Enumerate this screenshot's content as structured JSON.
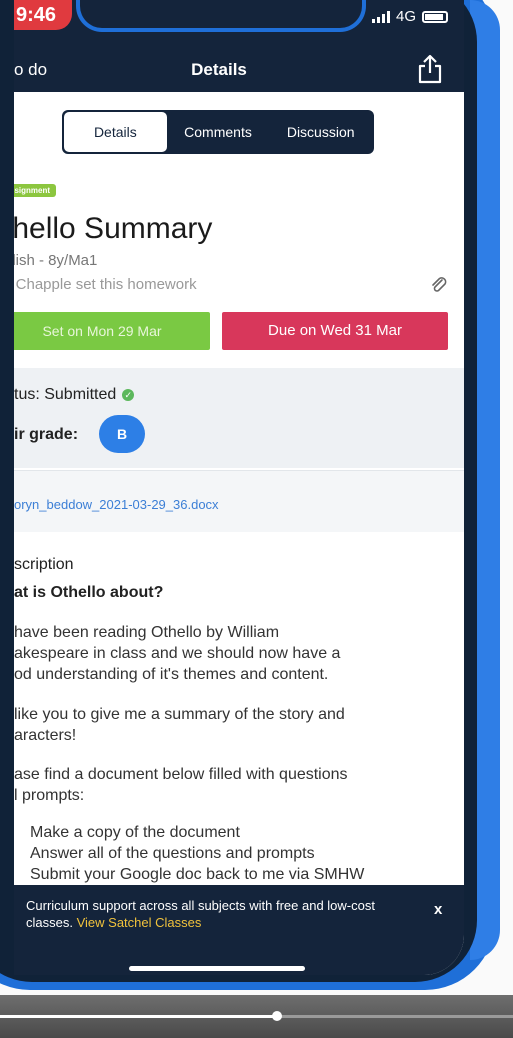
{
  "status_bar": {
    "time": "9:46",
    "network": "4G"
  },
  "nav": {
    "back_label": "o do",
    "title": "Details"
  },
  "tabs": [
    {
      "label": "Details",
      "active": true
    },
    {
      "label": "Comments",
      "active": false
    },
    {
      "label": "Discussion",
      "active": false
    }
  ],
  "homework": {
    "badge": "ssignment",
    "title": "thello Summary",
    "subject": "glish - 8y/Ma1",
    "set_by": "s Chapple set this homework",
    "set_date": "Set on Mon 29 Mar",
    "due_date": "Due on Wed 31 Mar"
  },
  "status": {
    "label": "tus: Submitted",
    "grade_label": "ir grade:",
    "grade_value": "B"
  },
  "attachment": {
    "filename": "oryn_beddow_2021-03-29_36.docx"
  },
  "description": {
    "heading": "scription",
    "subheading": "at is Othello about?",
    "paragraph1": [
      "have been reading Othello by William",
      "akespeare in class and we should now have a",
      "od understanding of it's themes and content."
    ],
    "paragraph2": [
      "like you to give me a summary of the story and",
      "aracters!"
    ],
    "paragraph3": [
      "ase find a document below filled with questions",
      "l prompts:"
    ],
    "steps": [
      "Make a copy of the document",
      "Answer all of the questions and prompts",
      "Submit your Google doc back to me via SMHW"
    ]
  },
  "banner": {
    "text": "Curriculum support across all subjects with free and low-cost classes.",
    "link": "View Satchel Classes",
    "close": "x"
  },
  "video": {
    "progress": 0.54
  },
  "colors": {
    "navy": "#14243b",
    "green": "#7ac943",
    "pink": "#d8375b",
    "blue": "#2d7fe6",
    "link_yellow": "#f0c23c"
  },
  "icons": {
    "share": "share-icon",
    "paperclip": "paperclip-icon",
    "check": "check-circle-icon",
    "close": "close-icon"
  }
}
